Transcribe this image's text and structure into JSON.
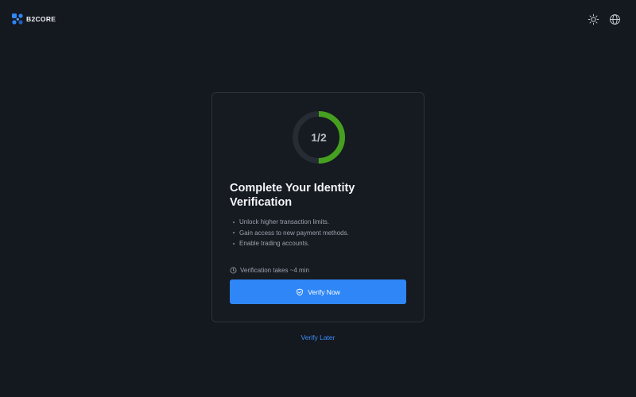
{
  "brand": {
    "name": "B2CORE",
    "accent": "#2f86f6"
  },
  "header": {
    "theme_icon": "sun-icon",
    "language_icon": "globe-icon"
  },
  "verification": {
    "progress": {
      "current": 1,
      "total": 2,
      "label": "1/2",
      "fraction": 0.5,
      "color": "#46a01f"
    },
    "title": "Complete Your Identity Verification",
    "benefits": [
      "Unlock higher transaction limits.",
      "Gain access to new payment methods.",
      "Enable trading accounts."
    ],
    "duration": "Verification takes ~4 min",
    "verify_button": "Verify Now"
  },
  "verify_later": "Verify Later"
}
